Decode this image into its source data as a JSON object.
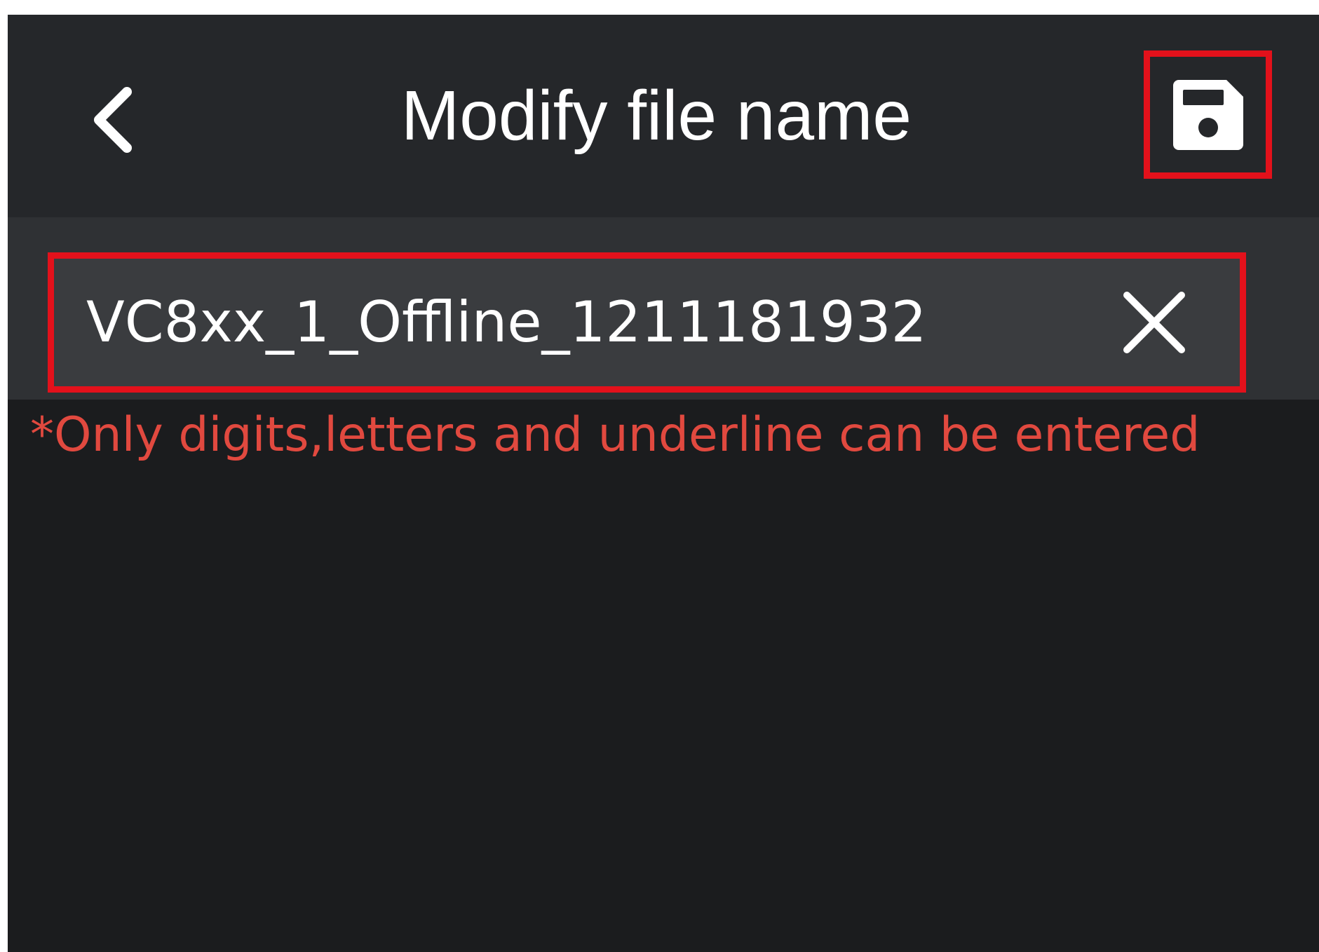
{
  "header": {
    "title": "Modify file name",
    "back_icon": "chevron-left-icon",
    "save_icon": "floppy-disk-save-icon"
  },
  "filename": {
    "value": "VC8xx_1_Offline_1211181932",
    "clear_icon": "close-icon"
  },
  "hint": "*Only digits,letters and underline can be entered",
  "colors": {
    "highlight_border": "#e3111b",
    "hint_text": "#e1493f",
    "header_bg": "#25272a",
    "body_bg": "#1b1c1e"
  }
}
